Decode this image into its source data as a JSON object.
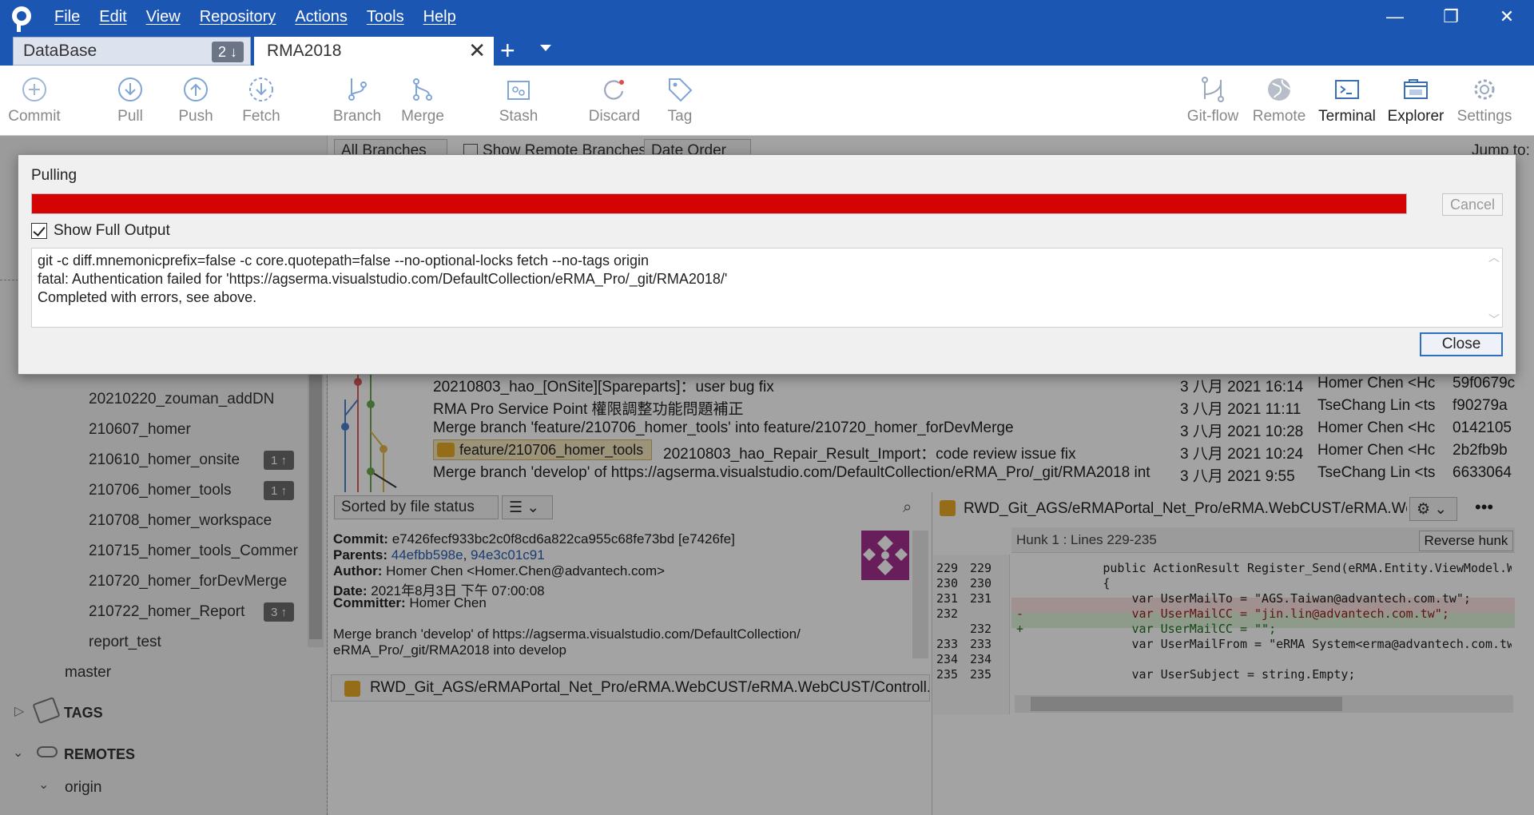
{
  "window": {
    "menu": [
      "File",
      "Edit",
      "View",
      "Repository",
      "Actions",
      "Tools",
      "Help"
    ],
    "controls": {
      "minimize": "—",
      "restore": "❐",
      "close": "✕"
    }
  },
  "tabs": [
    {
      "label": "DataBase",
      "badge": "2 ↓"
    },
    {
      "label": "RMA2018",
      "close": "✕"
    }
  ],
  "tab_add": "+",
  "toolbar": {
    "left": [
      {
        "label": "Commit",
        "icon": "commit-icon",
        "enabled": false
      },
      {
        "label": "Pull",
        "icon": "pull-icon",
        "enabled": false
      },
      {
        "label": "Push",
        "icon": "push-icon",
        "enabled": false
      },
      {
        "label": "Fetch",
        "icon": "fetch-icon",
        "enabled": false
      },
      {
        "label": "Branch",
        "icon": "branch-icon",
        "enabled": false
      },
      {
        "label": "Merge",
        "icon": "merge-icon",
        "enabled": false
      },
      {
        "label": "Stash",
        "icon": "stash-icon",
        "enabled": false
      },
      {
        "label": "Discard",
        "icon": "discard-icon",
        "enabled": false
      },
      {
        "label": "Tag",
        "icon": "tag-icon",
        "enabled": false
      }
    ],
    "right": [
      {
        "label": "Git-flow",
        "icon": "gitflow-icon",
        "enabled": false
      },
      {
        "label": "Remote",
        "icon": "globe-icon",
        "enabled": false
      },
      {
        "label": "Terminal",
        "icon": "terminal-icon",
        "enabled": true
      },
      {
        "label": "Explorer",
        "icon": "folder-icon",
        "enabled": true
      },
      {
        "label": "Settings",
        "icon": "gear-icon",
        "enabled": false
      }
    ]
  },
  "branch_bar": {
    "branches_select": "All Branches",
    "show_remote": "Show Remote Branches",
    "order_select": "Date Order",
    "jump_to": "Jump to:"
  },
  "sidebar": {
    "branches": [
      {
        "name": "20210220_zouman_addDN",
        "badge": ""
      },
      {
        "name": "210607_homer",
        "badge": ""
      },
      {
        "name": "210610_homer_onsite",
        "badge": "1 ↑"
      },
      {
        "name": "210706_homer_tools",
        "badge": "1 ↑"
      },
      {
        "name": "210708_homer_workspace",
        "badge": ""
      },
      {
        "name": "210715_homer_tools_Commer",
        "badge": ""
      },
      {
        "name": "210720_homer_forDevMerge",
        "badge": ""
      },
      {
        "name": "210722_homer_Report",
        "badge": "3 ↑"
      },
      {
        "name": "report_test",
        "badge": ""
      }
    ],
    "master": "master",
    "tags_header": "TAGS",
    "remotes_header": "REMOTES",
    "origin": "origin"
  },
  "commits": [
    {
      "message": "20210803_hao_[OnSite][Spareparts]：user bug fix",
      "date": "3 八月 2021 16:14",
      "author": "Homer Chen <Hc",
      "hash": "59f0679c"
    },
    {
      "message": "RMA Pro Service Point 權限調整功能問題補正",
      "date": "3 八月 2021 11:11",
      "author": "TseChang Lin <ts",
      "hash": "f90279a"
    },
    {
      "message": "Merge branch 'feature/210706_homer_tools' into feature/210720_homer_forDevMerge",
      "date": "3 八月 2021 10:28",
      "author": "Homer Chen <Hc",
      "hash": "0142105"
    },
    {
      "message": "20210803_hao_Repair_Result_Import：code review issue fix",
      "tag": "feature/210706_homer_tools",
      "date": "3 八月 2021 10:24",
      "author": "Homer Chen <Hc",
      "hash": "2b2fb9b"
    },
    {
      "message": "Merge branch 'develop' of https://agserma.visualstudio.com/DefaultCollection/eRMA_Pro/_git/RMA2018 int",
      "date": "3 八月 2021 9:55",
      "author": "TseChang Lin <ts",
      "hash": "6633064"
    }
  ],
  "file_pane": {
    "sort_select": "Sorted by file status",
    "commit_label": "Commit:",
    "commit_value": "e7426fecf933bc2c0f8cd6a822ca955c68fe73bd [e7426fe]",
    "parents_label": "Parents:",
    "parent1": "44efbb598e",
    "parent2": "94e3c01c91",
    "author_label": "Author:",
    "author_value": "Homer Chen <Homer.Chen@advantech.com>",
    "date_label": "Date:",
    "date_value": "2021年8月3日 下午 07:00:08",
    "committer_label": "Committer:",
    "committer_value": "Homer Chen",
    "message_line1": "Merge branch 'develop' of https://agserma.visualstudio.com/DefaultCollection/",
    "message_line2": "eRMA_Pro/_git/RMA2018 into develop",
    "file": "RWD_Git_AGS/eRMAPortal_Net_Pro/eRMA.WebCUST/eRMA.WebCUST/Controll..."
  },
  "diff_pane": {
    "file": "RWD_Git_AGS/eRMAPortal_Net_Pro/eRMA.WebCUST/eRMA.WebC...",
    "hunk": "Hunk 1 : Lines 229-235",
    "reverse": "Reverse hunk",
    "lines": [
      {
        "old": "229",
        "new": "229",
        "text": "            public ActionResult Register_Send(eRMA.Entity.ViewModel.Web",
        "kind": "ctx"
      },
      {
        "old": "230",
        "new": "230",
        "text": "            {",
        "kind": "ctx"
      },
      {
        "old": "231",
        "new": "231",
        "text": "                var UserMailTo = \"AGS.Taiwan@advantech.com.tw\";",
        "kind": "ctx"
      },
      {
        "old": "232",
        "new": "",
        "text": "-               var UserMailCC = \"jin.lin@advantech.com.tw\";",
        "kind": "del"
      },
      {
        "old": "",
        "new": "232",
        "text": "+               var UserMailCC = \"\";",
        "kind": "add"
      },
      {
        "old": "233",
        "new": "233",
        "text": "                var UserMailFrom = \"eRMA System<erma@advantech.com.tw>\"",
        "kind": "ctx"
      },
      {
        "old": "234",
        "new": "234",
        "text": "",
        "kind": "ctx"
      },
      {
        "old": "235",
        "new": "235",
        "text": "                var UserSubject = string.Empty;",
        "kind": "ctx"
      }
    ]
  },
  "dialog": {
    "title": "Pulling",
    "progress": 1.0,
    "progress_color": "#d40404",
    "cancel": "Cancel",
    "show_full_output": "Show Full Output",
    "output": [
      "git -c diff.mnemonicprefix=false -c core.quotepath=false --no-optional-locks fetch --no-tags origin",
      "fatal: Authentication failed for 'https://agserma.visualstudio.com/DefaultCollection/eRMA_Pro/_git/RMA2018/'",
      "Completed with errors, see above."
    ],
    "close": "Close"
  },
  "colors": {
    "titlebar": "#1c56b3",
    "progress": "#d40404",
    "accent": "#2f6fc2"
  }
}
